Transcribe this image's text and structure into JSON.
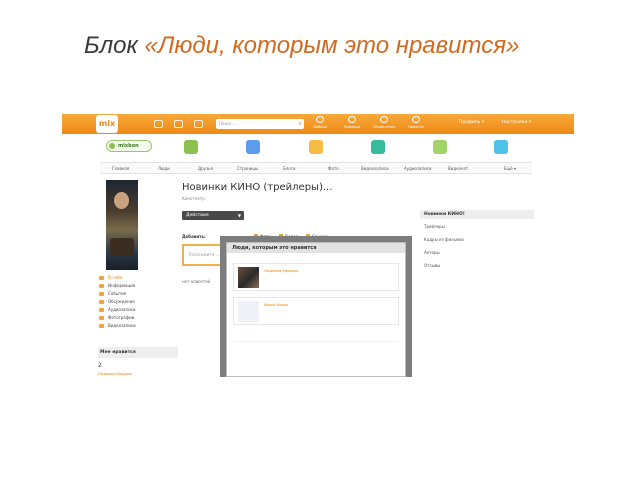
{
  "slide": {
    "title_prefix": "Блок ",
    "title_quoted": "«Люди, которым это нравится»"
  },
  "topbar": {
    "logo": "mix",
    "search_placeholder": "Поиск...",
    "nav": [
      {
        "label": "Мобиль",
        "icon": "mobile-icon"
      },
      {
        "label": "Ярмарка",
        "icon": "fair-icon"
      },
      {
        "label": "Объявления",
        "icon": "ads-icon"
      },
      {
        "label": "Новости",
        "icon": "news-icon"
      }
    ],
    "right_links": [
      "Профиль ▾",
      "Настройки ▾"
    ],
    "colors": {
      "bar": "#ef8a15",
      "accent": "#e67e00"
    }
  },
  "appbar": {
    "mixbon_label": "mixbon"
  },
  "menubar": {
    "items": [
      "Главная",
      "Люди",
      "Друзья",
      "Страницы",
      "Блоги",
      "Фото",
      "Видеозаписи",
      "Аудиозаписи",
      "Видеочат",
      "Ещё ▾"
    ]
  },
  "left": {
    "menu": [
      "О себе",
      "Информация",
      "События",
      "Обсуждения",
      "Аудиозаписи",
      "Фотографии",
      "Видеозаписи"
    ],
    "likes_title": "Мне нравится",
    "likes_count": "2",
    "likes_person": "Людмила Кордина"
  },
  "main": {
    "group_title": "Новинки КИНО (трейлеры)...",
    "group_sub": "Кинотеатр",
    "actions_label": "Действия",
    "add_label": "Добавить:",
    "add_options": [
      "Фото",
      "Видео",
      "Ссылки"
    ],
    "post_placeholder": "Расскажите ...",
    "no_news": "нет новостей"
  },
  "right": {
    "head": "Новинки КИНО!",
    "links": [
      "Трейлеры",
      "Кадры из фильмов",
      "Актеры",
      "Отзывы"
    ]
  },
  "modal": {
    "title": "Люди, которым это нравится",
    "people": [
      {
        "name": "Людмила Кордина"
      },
      {
        "name": "Ирина Ходко"
      }
    ]
  }
}
